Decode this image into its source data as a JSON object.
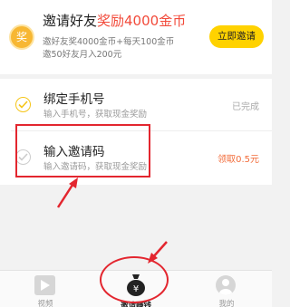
{
  "banner": {
    "coin_label": "奖",
    "title_prefix": "邀请好友",
    "title_highlight": "奖励4000金币",
    "line1": "邀好友奖4000金币+每天100金币",
    "line2": "邀50好友月入200元",
    "invite_button": "立即邀请"
  },
  "tasks": [
    {
      "title": "绑定手机号",
      "desc": "输入手机号，获取现金奖励",
      "status": "已完成"
    },
    {
      "title": "输入邀请码",
      "desc": "输入邀请码，获取现金奖励",
      "status": "领取0.5元"
    }
  ],
  "tabbar": {
    "tabs": [
      {
        "label": "视频"
      },
      {
        "label": "邀请赚钱",
        "active": true
      },
      {
        "label": "我的"
      }
    ]
  },
  "colors": {
    "accent_yellow": "#ffd200",
    "highlight_red": "#f24a3a",
    "reward_orange": "#f26c3a",
    "annotation_red": "#e3262f"
  },
  "icons": {
    "banner": "coin-icon",
    "task_done": "check-circle-icon",
    "task_pending": "check-circle-outline-icon",
    "tab_video": "play-icon",
    "tab_invite": "money-bag-icon",
    "tab_mine": "user-icon"
  }
}
